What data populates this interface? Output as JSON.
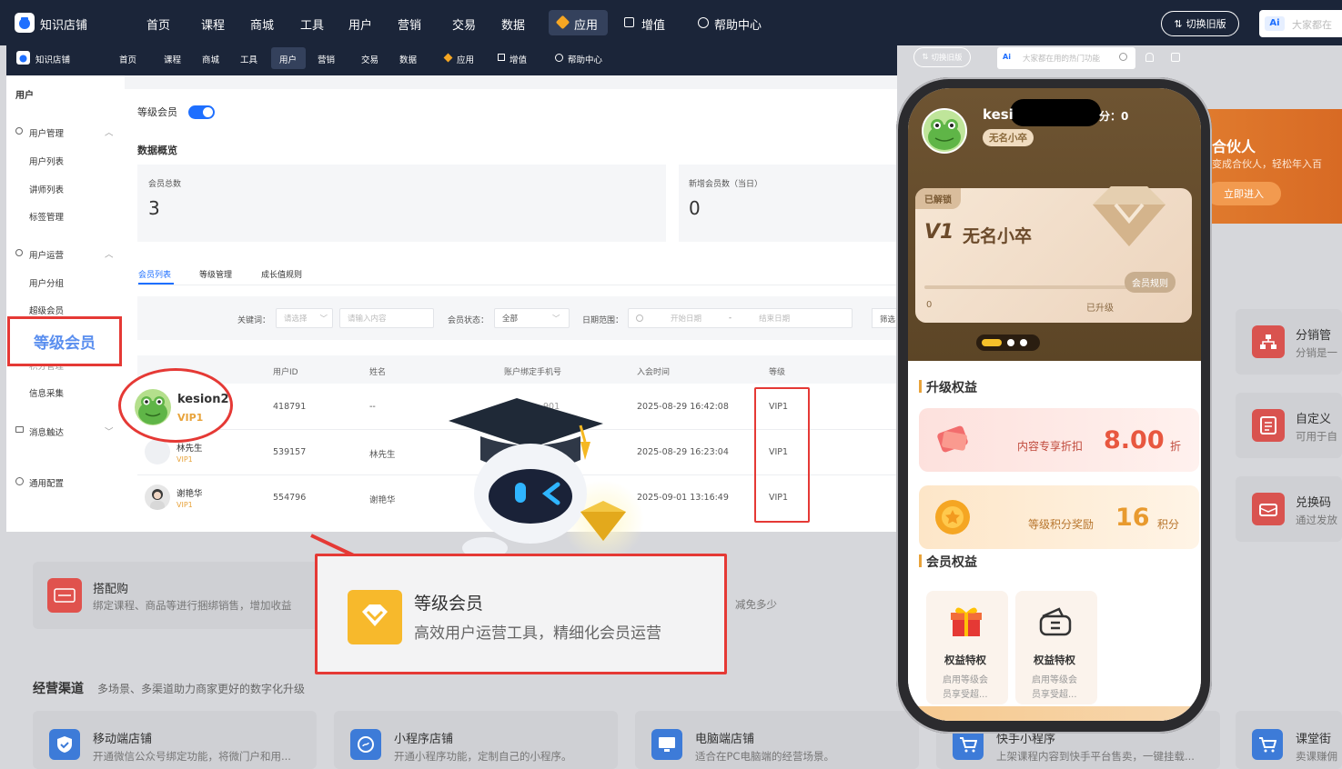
{
  "colors": {
    "accent": "#1e6fff",
    "vip": "#e8a33b",
    "highlight_red": "#e53935",
    "phone_brown": "#6e5432",
    "dark_nav": "#1b2539"
  },
  "bg": {
    "logo_text": "知识店铺",
    "nav": [
      "首页",
      "课程",
      "商城",
      "工具",
      "用户",
      "营销",
      "交易",
      "数据",
      "应用",
      "增值",
      "帮助中心"
    ],
    "switch_label": "切换旧版",
    "search_placeholder": "大家都在",
    "ai_label": "Ai",
    "partner_title": "合伙人",
    "partner_desc": "变成合伙人，轻松年入百",
    "partner_btn": "立即进入",
    "right_cards": [
      {
        "title": "分销管",
        "desc": "分销是一",
        "icon": "sitemap-icon"
      },
      {
        "title": "自定义",
        "desc": "可用于自",
        "icon": "form-icon"
      },
      {
        "title": "兑换码",
        "desc": "通过发放",
        "icon": "ticket-icon"
      }
    ],
    "bundle": {
      "title": "搭配购",
      "desc": "绑定课程、商品等进行捆绑销售，增加收益"
    },
    "discount_text": "减免多少",
    "channels_title": "经营渠道",
    "channels_sub": "多场景、多渠道助力商家更好的数字化升级",
    "channels": [
      {
        "title": "移动端店铺",
        "desc": "开通微信公众号绑定功能，将微门户和用..."
      },
      {
        "title": "小程序店铺",
        "desc": "开通小程序功能，定制自己的小程序。"
      },
      {
        "title": "电脑端店铺",
        "desc": "适合在PC电脑端的经营场景。"
      },
      {
        "title": "快手小程序",
        "desc": "上架课程内容到快手平台售卖，一键挂载..."
      },
      {
        "title": "课堂街",
        "desc": "卖课赚佣"
      }
    ]
  },
  "front": {
    "logo_text": "知识店铺",
    "nav": [
      "首页",
      "课程",
      "商城",
      "工具",
      "用户",
      "营销",
      "交易",
      "数据",
      "应用",
      "增值",
      "帮助中心"
    ],
    "active_nav": "用户",
    "switch_label": "切换旧版",
    "search_placeholder": "大家都在用的热门功能",
    "ai_label": "Ai",
    "sidebar": {
      "title": "用户",
      "group1": "用户管理",
      "group1_items": [
        "用户列表",
        "讲师列表",
        "标签管理"
      ],
      "group2": "用户运营",
      "group2_items": [
        "用户分组",
        "超级会员"
      ],
      "highlight": "等级会员",
      "partial_item": "积分管理",
      "info_item": "信息采集",
      "msg": "消息触达",
      "config": "通用配置"
    },
    "page": {
      "toggle_label": "等级会员",
      "toggle_on": true,
      "overview_title": "数据概览",
      "stat1_label": "会员总数",
      "stat1_value": "3",
      "stat2_label": "新增会员数（当日）",
      "stat2_value": "0",
      "tabs": [
        "会员列表",
        "等级管理",
        "成长值规则"
      ],
      "active_tab": "会员列表",
      "filter": {
        "keyword_label": "关键词：",
        "keyword_select": "请选择",
        "keyword_input": "请输入内容",
        "status_label": "会员状态：",
        "status_value": "全部",
        "date_label": "日期范围：",
        "date_start": "开始日期",
        "date_sep": "-",
        "date_end": "结束日期",
        "filter_btn": "筛选"
      },
      "columns": [
        "用户ID",
        "姓名",
        "账户绑定手机号",
        "入会时间",
        "等级"
      ],
      "rows": [
        {
          "name": "kesion2",
          "level": "VIP1",
          "id": "418791",
          "real": "--",
          "phone": "",
          "time": "2025-08-29 16:42:08",
          "grade": "VIP1"
        },
        {
          "name": "林先生",
          "level": "VIP1",
          "id": "539157",
          "real": "林先生",
          "phone": "",
          "time": "2025-08-29 16:23:04",
          "grade": "VIP1"
        },
        {
          "name": "谢艳华",
          "level": "VIP1",
          "id": "554796",
          "real": "谢艳华",
          "phone": "",
          "time": "2025-09-01 13:16:49",
          "grade": "VIP1"
        }
      ],
      "phone_partial": "1",
      "phone_partial2": "901"
    }
  },
  "callout": {
    "title": "等级会员",
    "desc": "高效用户运营工具，精细化会员运营"
  },
  "phone": {
    "user_name": "kesi",
    "points_text": "分：0",
    "badge": "无名小卒",
    "unlocked": "已解锁",
    "vip_level": "V1",
    "vip_name": "无名小卒",
    "progress_start": "0",
    "progress_end": "已升级",
    "rules_btn": "会员规则",
    "upgrade_title": "升级权益",
    "perk1_label": "内容专享折扣",
    "perk1_value": "8.00",
    "perk1_unit": "折",
    "perk2_label": "等级积分奖励",
    "perk2_value": "16",
    "perk2_unit": "积分",
    "member_title": "会员权益",
    "benefits": [
      {
        "title": "权益特权",
        "desc1": "启用等级会",
        "desc2": "员享受超...",
        "icon": "gift-icon"
      },
      {
        "title": "权益特权",
        "desc1": "启用等级会",
        "desc2": "员享受超...",
        "icon": "coupon-icon"
      }
    ]
  }
}
